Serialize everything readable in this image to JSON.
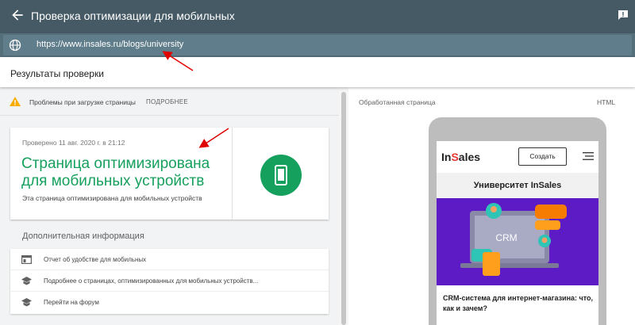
{
  "topbar": {
    "title": "Проверка оптимизации для мобильных",
    "back_icon": "arrow-back-icon",
    "feedback_icon": "feedback-icon"
  },
  "url_bar": {
    "url": "https://www.insales.ru/blogs/university",
    "icon": "globe-icon"
  },
  "results": {
    "heading": "Результаты проверки"
  },
  "warning": {
    "text": "Проблемы при загрузке страницы",
    "more": "ПОДРОБНЕЕ",
    "icon": "warning-icon"
  },
  "verdict": {
    "date": "Проверено 11 авг. 2020 г. в 21:12",
    "title": "Страница оптимизирована для мобильных устройств",
    "subtitle": "Эта страница оптимизирована для мобильных устройств",
    "icon": "smartphone-icon",
    "color": "#16a05d"
  },
  "additional": {
    "heading": "Дополнительная информация",
    "items": [
      {
        "label": "Отчет об удобстве для мобильных",
        "icon": "report-icon"
      },
      {
        "label": "Подробнее о страницах, оптимизированных для мобильных устройств...",
        "icon": "school-icon"
      },
      {
        "label": "Перейти на форум",
        "icon": "school-icon"
      }
    ]
  },
  "preview": {
    "heading": "Обработанная страница",
    "html_tab": "HTML",
    "site": {
      "brand_before": "In",
      "brand_s": "S",
      "brand_after": "ales",
      "create_button": "Создать",
      "hero_title": "Университет InSales",
      "banner_label": "CRM",
      "article_title": "CRM-система для интернет-магазина: что, как и зачем?"
    }
  },
  "annotation_arrows": 2
}
